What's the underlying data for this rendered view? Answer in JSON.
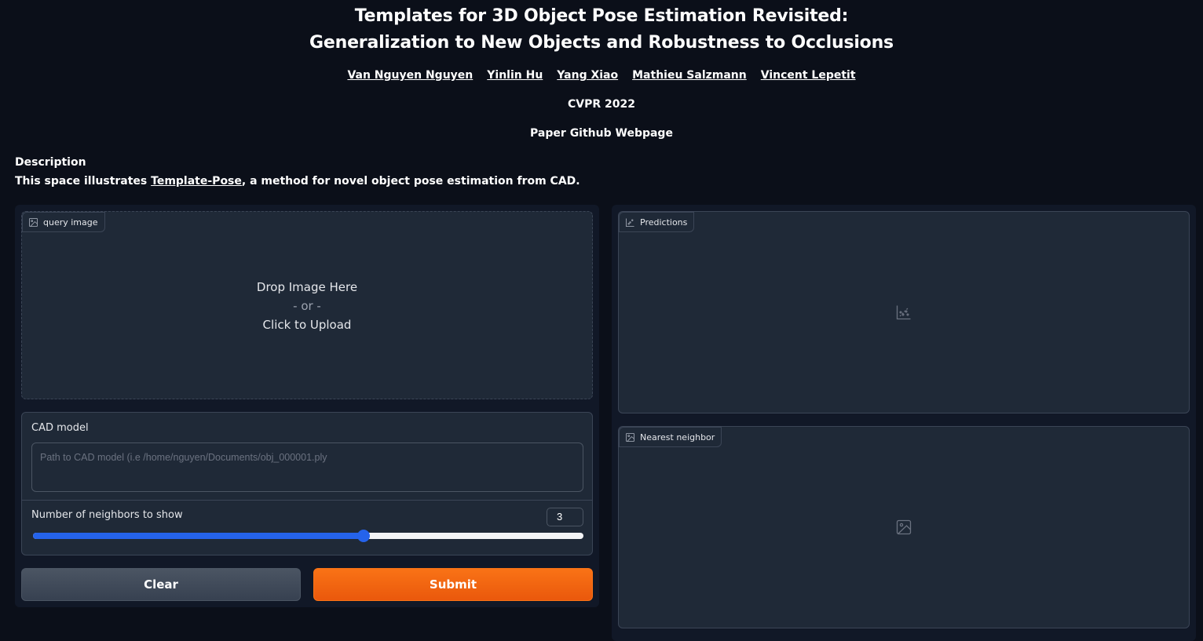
{
  "header": {
    "title_line1": "Templates for 3D Object Pose Estimation Revisited:",
    "title_line2": "Generalization to New Objects and Robustness to Occlusions",
    "authors": [
      "Van Nguyen Nguyen",
      "Yinlin Hu",
      "Yang Xiao",
      "Mathieu Salzmann",
      "Vincent Lepetit"
    ],
    "venue": "CVPR 2022",
    "links": [
      "Paper",
      "Github",
      "Webpage"
    ]
  },
  "description": {
    "title": "Description",
    "text_before": "This space illustrates ",
    "link_text": "Template-Pose",
    "text_after": ", a method for novel object pose estimation from CAD."
  },
  "query_image": {
    "label": "query image",
    "icon": "image-icon",
    "drop_line1": "Drop Image Here",
    "drop_or": "- or -",
    "drop_line2": "Click to Upload"
  },
  "cad_model": {
    "label": "CAD model",
    "value": "",
    "placeholder": "Path to CAD model (i.e /home/nguyen/Documents/obj_000001.ply"
  },
  "neighbors": {
    "label": "Number of neighbors to show",
    "value": "3",
    "slider_fraction": 0.6
  },
  "buttons": {
    "clear": "Clear",
    "submit": "Submit"
  },
  "outputs": {
    "predictions_label": "Predictions",
    "predictions_icon": "chart-icon",
    "nearest_label": "Nearest neighbor",
    "nearest_icon": "image-icon"
  },
  "colors": {
    "background": "#0b0f19",
    "panel": "#111827",
    "block": "#1f2937",
    "accent_blue": "#2563eb",
    "submit_orange": "#f97316"
  }
}
